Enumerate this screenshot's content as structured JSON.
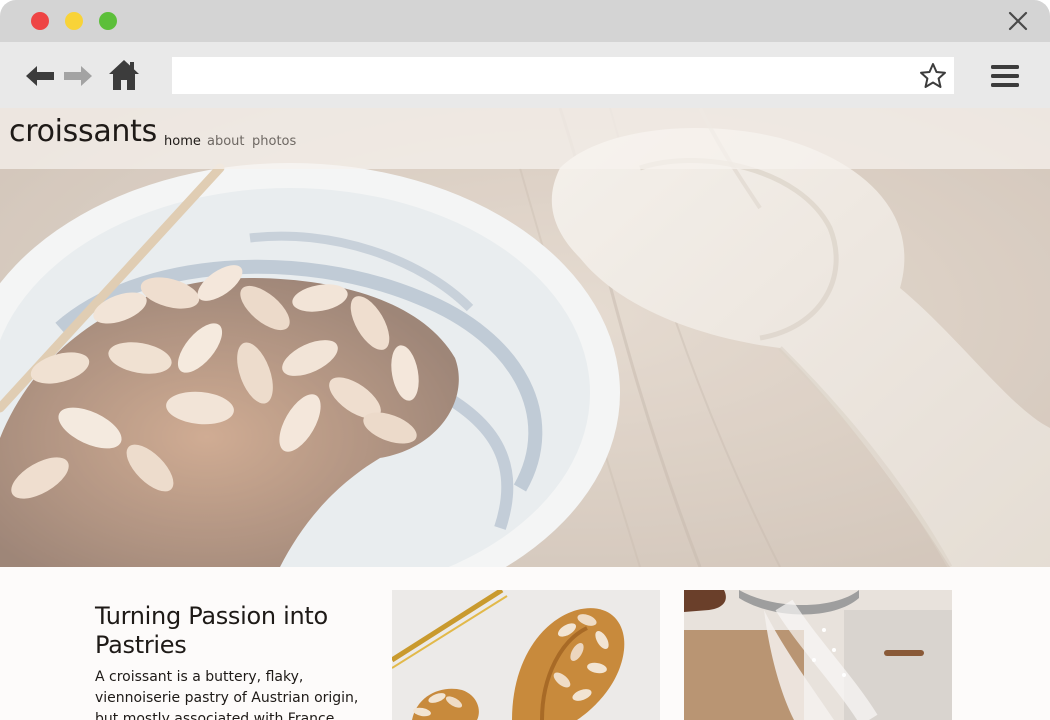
{
  "window": {
    "icons": {
      "close": "close-icon",
      "minimize": "minimize-dot-icon",
      "maximize": "maximize-dot-icon"
    },
    "colors": {
      "red": "#ee4444",
      "yellow": "#f8d338",
      "green": "#5cbf3a"
    }
  },
  "toolbar": {
    "url_value": "",
    "icons": [
      "back-arrow-icon",
      "forward-arrow-icon",
      "home-icon",
      "star-icon",
      "hamburger-menu-icon"
    ]
  },
  "site": {
    "brand": "croissants",
    "nav": [
      {
        "label": "home"
      },
      {
        "label": "about"
      },
      {
        "label": "photos"
      }
    ]
  },
  "article": {
    "title": "Turning Passion into Pastries",
    "body": "A croissant is a buttery, flaky, viennoiserie pastry of Austrian origin, but mostly associated with France."
  },
  "gallery": {
    "items": [
      "almond-croissant-photo",
      "flour-sifting-photo"
    ]
  }
}
